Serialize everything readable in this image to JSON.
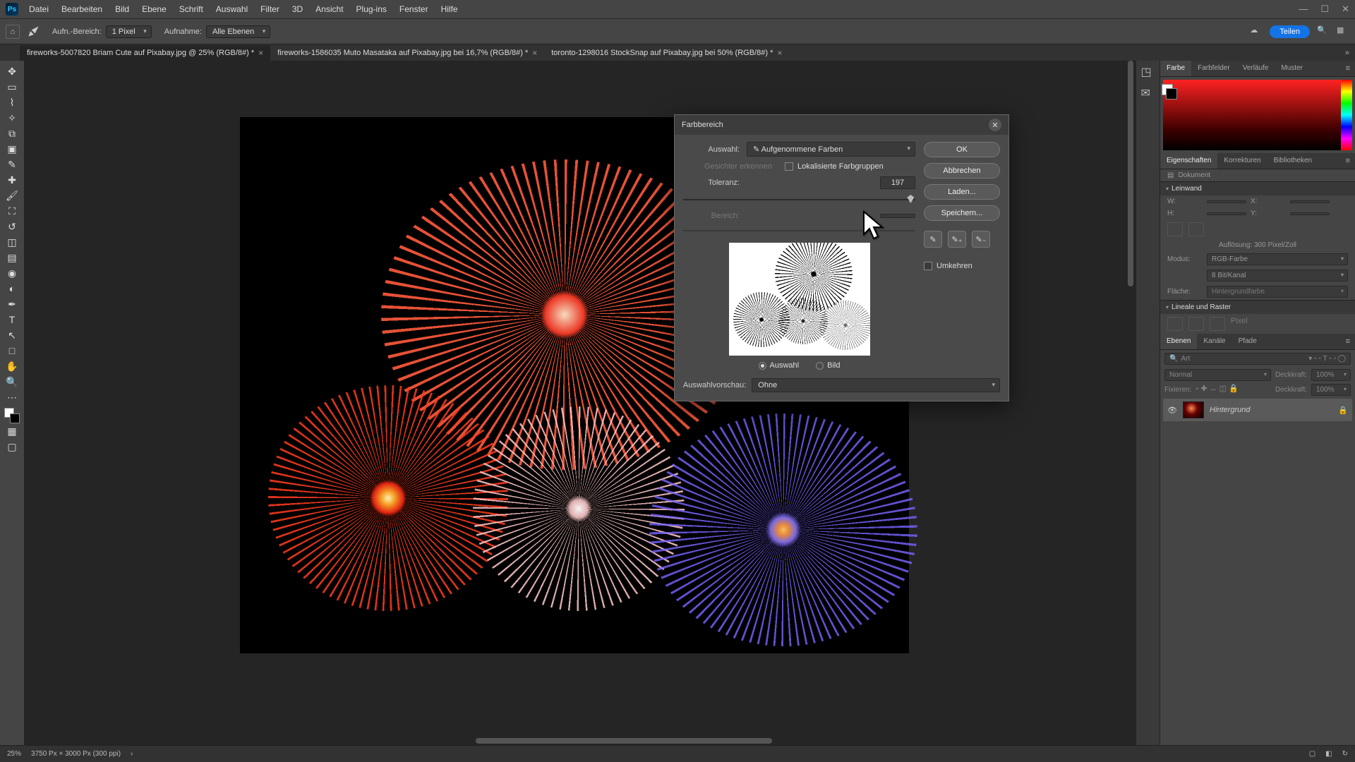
{
  "window_controls": {
    "min": "—",
    "max": "☐",
    "close": "✕"
  },
  "menu": [
    "Datei",
    "Bearbeiten",
    "Bild",
    "Ebene",
    "Schrift",
    "Auswahl",
    "Filter",
    "3D",
    "Ansicht",
    "Plug-ins",
    "Fenster",
    "Hilfe"
  ],
  "options": {
    "sample_label": "Aufn.-Bereich:",
    "sample_value": "1 Pixel",
    "sample2_label": "Aufnahme:",
    "sample2_value": "Alle Ebenen",
    "share": "Teilen"
  },
  "tabs": [
    {
      "label": "fireworks-5007820 Briam Cute auf Pixabay.jpg @ 25% (RGB/8#) *",
      "active": true
    },
    {
      "label": "fireworks-1586035 Muto Masataka auf Pixabay.jpg bei 16,7% (RGB/8#) *",
      "active": false
    },
    {
      "label": "toronto-1298016 StockSnap auf Pixabay.jpg bei 50% (RGB/8#) *",
      "active": false
    }
  ],
  "panels": {
    "color_tabs": [
      "Farbe",
      "Farbfelder",
      "Verläufe",
      "Muster"
    ],
    "props_tabs": [
      "Eigenschaften",
      "Korrekturen",
      "Bibliotheken"
    ],
    "doc_label": "Dokument",
    "sections": {
      "canvas": "Leinwand",
      "rulers": "Lineale und Raster"
    },
    "props": {
      "w_label": "W:",
      "x_label": "X:",
      "h_label": "H:",
      "y_label": "Y:",
      "resolution": "Auflösung: 300 Pixel/Zoll",
      "mode_label": "Modus:",
      "mode_value": "RGB-Farbe",
      "depth_value": "8 Bit/Kanal",
      "fill_label": "Fläche:",
      "fill_value": "Hintergrundfarbe",
      "grid_label": "Pixel"
    },
    "layers_tabs": [
      "Ebenen",
      "Kanäle",
      "Pfade"
    ],
    "layers": {
      "search_placeholder": "Art",
      "blend": "Normal",
      "opacity_label": "Deckkraft:",
      "opacity_value": "100%",
      "lock_label": "Fixieren:",
      "fill_label": "Deckkraft:",
      "fill_value": "100%",
      "layer_name": "Hintergrund"
    }
  },
  "dialog": {
    "title": "Farbbereich",
    "select_label": "Auswahl:",
    "select_value": "Aufgenommene Farben",
    "faces_label": "Gesichter erkennen",
    "localized_label": "Lokalisierte Farbgruppen",
    "tolerance_label": "Toleranz:",
    "tolerance_value": "197",
    "range_label": "Bereich:",
    "radio_selection": "Auswahl",
    "radio_image": "Bild",
    "preview_label": "Auswahlvorschau:",
    "preview_value": "Ohne",
    "buttons": {
      "ok": "OK",
      "cancel": "Abbrechen",
      "load": "Laden...",
      "save": "Speichern..."
    },
    "invert_label": "Umkehren"
  },
  "status": {
    "zoom": "25%",
    "docinfo": "3750 Px × 3000 Px (300 ppi)"
  }
}
